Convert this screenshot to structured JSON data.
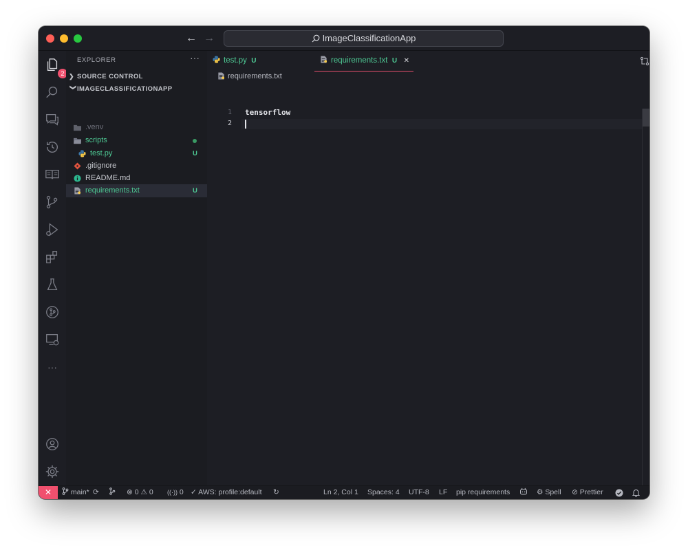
{
  "titlebar": {
    "search_text": "ImageClassificationApp"
  },
  "activity": {
    "explorer_badge": "2"
  },
  "sidebar": {
    "header": "EXPLORER",
    "more": "···",
    "sections": {
      "source_control": "SOURCE CONTROL",
      "project": "IMAGECLASSIFICATIONAPP"
    },
    "items": [
      {
        "label": ".venv",
        "status": ""
      },
      {
        "label": "scripts",
        "status": ""
      },
      {
        "label": "test.py",
        "status": "U"
      },
      {
        "label": ".gitignore",
        "status": ""
      },
      {
        "label": "README.md",
        "status": ""
      },
      {
        "label": "requirements.txt",
        "status": "U"
      }
    ]
  },
  "tabs": [
    {
      "label": "test.py",
      "status": "U"
    },
    {
      "label": "requirements.txt",
      "status": "U",
      "close": "✕"
    }
  ],
  "breadcrumb": "requirements.txt",
  "editor": {
    "lines": [
      {
        "number": "1",
        "text": "tensorflow"
      },
      {
        "number": "2",
        "text": ""
      }
    ]
  },
  "statusbar": {
    "remote": "✕",
    "branch": "main*",
    "errors": "0",
    "warnings": "0",
    "ports": "0",
    "aws": "AWS: profile:default",
    "position": "Ln 2, Col 1",
    "spaces": "Spaces: 4",
    "encoding": "UTF-8",
    "eol": "LF",
    "language": "pip requirements",
    "spell": "Spell",
    "prettier": "Prettier"
  },
  "colors": {
    "accent": "#f0506e",
    "untracked": "#4ec994",
    "background": "#1d1e24"
  }
}
